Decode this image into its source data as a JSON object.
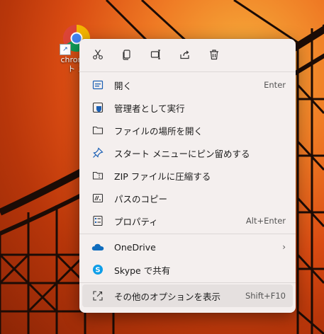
{
  "desktop": {
    "shortcut_label_line1": "chrome.",
    "shortcut_label_line2": "ト ス"
  },
  "context_menu": {
    "toolbar": [
      {
        "name": "cut-icon"
      },
      {
        "name": "copy-icon"
      },
      {
        "name": "rename-icon"
      },
      {
        "name": "share-icon"
      },
      {
        "name": "delete-icon"
      }
    ],
    "items": [
      {
        "label": "開く",
        "shortcut": "Enter",
        "icon": "open-icon"
      },
      {
        "label": "管理者として実行",
        "shortcut": "",
        "icon": "admin-shield-icon"
      },
      {
        "label": "ファイルの場所を開く",
        "shortcut": "",
        "icon": "folder-icon"
      },
      {
        "label": "スタート メニューにピン留めする",
        "shortcut": "",
        "icon": "pin-icon"
      },
      {
        "label": "ZIP ファイルに圧縮する",
        "shortcut": "",
        "icon": "zip-folder-icon"
      },
      {
        "label": "パスのコピー",
        "shortcut": "",
        "icon": "copy-path-icon"
      },
      {
        "label": "プロパティ",
        "shortcut": "Alt+Enter",
        "icon": "properties-icon"
      }
    ],
    "onedrive": {
      "label": "OneDrive",
      "icon": "onedrive-icon"
    },
    "skype": {
      "label": "Skype で共有",
      "icon": "skype-icon"
    },
    "more_options": {
      "label": "その他のオプションを表示",
      "shortcut": "Shift+F10",
      "icon": "more-options-icon"
    }
  }
}
